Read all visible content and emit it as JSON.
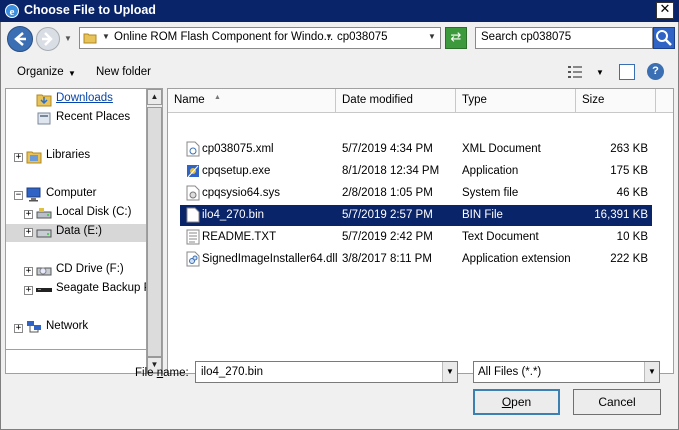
{
  "window": {
    "title": "Choose File to Upload",
    "close_glyph": "✕"
  },
  "navbar": {
    "breadcrumb": [
      "Online ROM Flash Component for Windo...",
      "cp038075"
    ],
    "search_placeholder": "Search cp038075"
  },
  "toolbar": {
    "organize_label": "Organize",
    "new_folder_label": "New folder",
    "help_glyph": "?"
  },
  "nav_pane": {
    "items": [
      {
        "label": "Downloads",
        "icon": "downloads-folder-icon"
      },
      {
        "label": "Recent Places",
        "icon": "recent-places-icon"
      },
      {
        "label": "Libraries",
        "icon": "libraries-icon"
      },
      {
        "label": "Computer",
        "icon": "computer-icon"
      },
      {
        "label": "Local Disk (C:)",
        "icon": "local-disk-icon"
      },
      {
        "label": "Data (E:)",
        "icon": "drive-icon"
      },
      {
        "label": "CD Drive (F:)",
        "icon": "cd-drive-icon"
      },
      {
        "label": "Seagate Backup Plu",
        "icon": "external-drive-icon"
      },
      {
        "label": "Network",
        "icon": "network-icon"
      }
    ]
  },
  "file_list": {
    "columns": [
      "Name",
      "Date modified",
      "Type",
      "Size"
    ],
    "rows": [
      {
        "name": "cp038075.xml",
        "date": "5/7/2019 4:34 PM",
        "type": "XML Document",
        "size": "263 KB",
        "icon": "xml-file-icon"
      },
      {
        "name": "cpqsetup.exe",
        "date": "8/1/2018 12:34 PM",
        "type": "Application",
        "size": "175 KB",
        "icon": "exe-file-icon"
      },
      {
        "name": "cpqsysio64.sys",
        "date": "2/8/2018 1:05 PM",
        "type": "System file",
        "size": "46 KB",
        "icon": "sys-file-icon"
      },
      {
        "name": "ilo4_270.bin",
        "date": "5/7/2019 2:57 PM",
        "type": "BIN File",
        "size": "16,391 KB",
        "icon": "bin-file-icon"
      },
      {
        "name": "README.TXT",
        "date": "5/7/2019 2:42 PM",
        "type": "Text Document",
        "size": "10 KB",
        "icon": "text-file-icon"
      },
      {
        "name": "SignedImageInstaller64.dll",
        "date": "3/8/2017 8:11 PM",
        "type": "Application extension",
        "size": "222 KB",
        "icon": "dll-file-icon"
      }
    ],
    "selected_index": 3
  },
  "bottom": {
    "file_name_label_pre": "File ",
    "file_name_label_u": "n",
    "file_name_label_post": "ame:",
    "file_name_value": "ilo4_270.bin",
    "file_type_value": "All Files (*.*)",
    "open_pre": "",
    "open_u": "O",
    "open_post": "pen",
    "cancel_label": "Cancel"
  },
  "colors": {
    "title_bar": "#0a246a",
    "selection": "#0a246a",
    "link": "#0645ad"
  }
}
